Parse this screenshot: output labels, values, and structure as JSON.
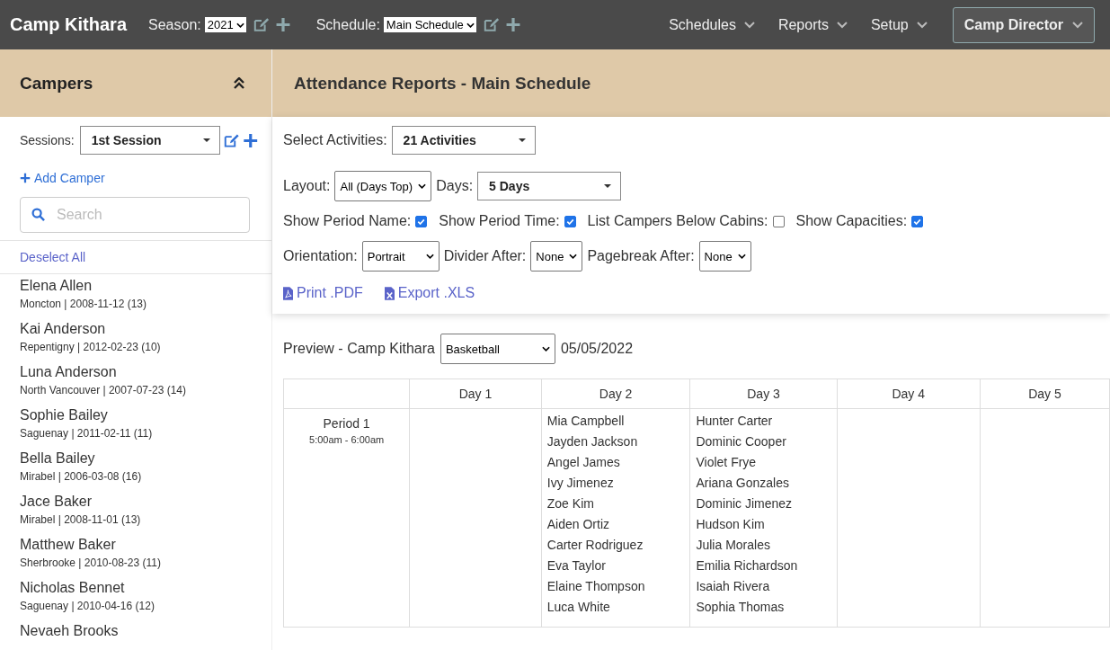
{
  "topbar": {
    "brand": "Camp Kithara",
    "season": {
      "label": "Season:",
      "value": "2021"
    },
    "schedule": {
      "label": "Schedule:",
      "value": "Main Schedule"
    },
    "menus": [
      "Schedules",
      "Reports",
      "Setup"
    ],
    "user": "Camp Director"
  },
  "sidebar": {
    "title": "Campers",
    "sessions": {
      "label": "Sessions:",
      "value": "1st Session"
    },
    "add_camper": "Add Camper",
    "search": {
      "placeholder": "Search"
    },
    "deselect_all": "Deselect All",
    "campers": [
      {
        "name": "Elena Allen",
        "detail": "Moncton | 2008-11-12 (13)"
      },
      {
        "name": "Kai Anderson",
        "detail": "Repentigny | 2012-02-23 (10)"
      },
      {
        "name": "Luna Anderson",
        "detail": "North Vancouver | 2007-07-23 (14)"
      },
      {
        "name": "Sophie Bailey",
        "detail": "Saguenay | 2011-02-11 (11)"
      },
      {
        "name": "Bella Bailey",
        "detail": "Mirabel | 2006-03-08 (16)"
      },
      {
        "name": "Jace Baker",
        "detail": "Mirabel | 2008-11-01 (13)"
      },
      {
        "name": "Matthew Baker",
        "detail": "Sherbrooke | 2010-08-23 (11)"
      },
      {
        "name": "Nicholas Bennet",
        "detail": "Saguenay | 2010-04-16 (12)"
      },
      {
        "name": "Nevaeh Brooks"
      }
    ]
  },
  "main": {
    "title": "Attendance Reports - Main Schedule",
    "activities": {
      "label": "Select Activities:",
      "value": "21 Activities"
    },
    "layout": {
      "label": "Layout:",
      "value": "All (Days Top)"
    },
    "days": {
      "label": "Days:",
      "value": "5 Days"
    },
    "checkboxes": [
      {
        "label": "Show Period Name:",
        "checked": true
      },
      {
        "label": "Show Period Time:",
        "checked": true
      },
      {
        "label": "List Campers Below Cabins:",
        "checked": false
      },
      {
        "label": "Show Capacities:",
        "checked": true
      }
    ],
    "orientation": {
      "label": "Orientation:",
      "value": "Portrait"
    },
    "divider": {
      "label": "Divider After:",
      "value": "None"
    },
    "pagebreak": {
      "label": "Pagebreak After:",
      "value": "None"
    },
    "actions": [
      {
        "label": "Print .PDF",
        "kind": "pdf"
      },
      {
        "label": "Export .XLS",
        "kind": "xls"
      }
    ],
    "preview": {
      "label": "Preview - Camp Kithara",
      "activity": "Basketball",
      "date": "05/05/2022"
    },
    "table": {
      "columns": [
        "Day 1",
        "Day 2",
        "Day 3",
        "Day 4",
        "Day 5"
      ],
      "rows": [
        {
          "period": "Period 1",
          "time": "5:00am - 6:00am",
          "cells": [
            [],
            [
              "Mia Campbell",
              "Jayden Jackson",
              "Angel James",
              "Ivy Jimenez",
              "Zoe Kim",
              "Aiden Ortiz",
              "Carter Rodriguez",
              "Eva Taylor",
              "Elaine Thompson",
              "Luca White"
            ],
            [
              "Hunter Carter",
              "Dominic Cooper",
              "Violet Frye",
              "Ariana Gonzales",
              "Dominic Jimenez",
              "Hudson Kim",
              "Julia Morales",
              "Emilia Richardson",
              "Isaiah Rivera",
              "Sophia Thomas"
            ],
            [],
            []
          ]
        }
      ]
    }
  }
}
